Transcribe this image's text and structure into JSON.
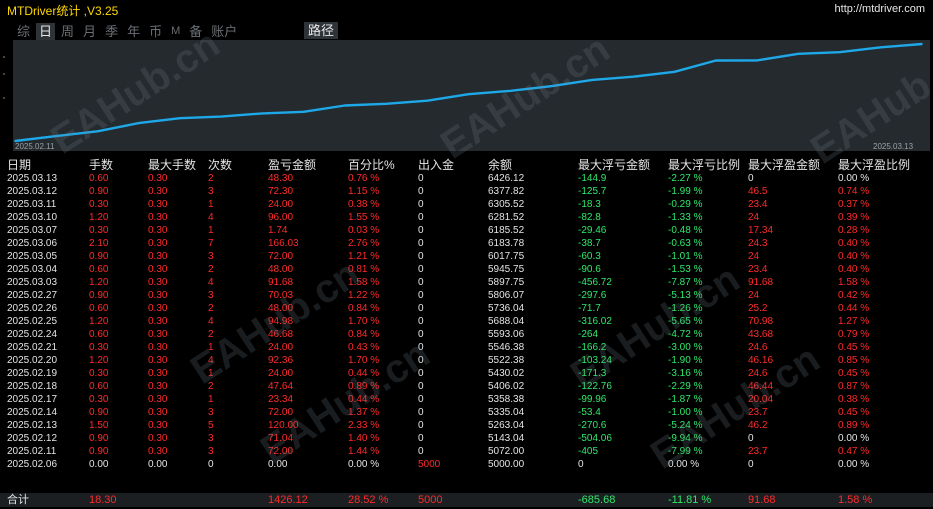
{
  "app": {
    "title": "MTDriver统计 ,V3.25",
    "url": "http://mtdriver.com"
  },
  "nav": {
    "items": [
      {
        "label": "综",
        "active": false
      },
      {
        "label": "日",
        "active": true
      },
      {
        "label": "周",
        "active": false
      },
      {
        "label": "月",
        "active": false
      },
      {
        "label": "季",
        "active": false
      },
      {
        "label": "年",
        "active": false
      },
      {
        "label": "币",
        "active": false
      },
      {
        "label": "M",
        "active": false
      },
      {
        "label": "备",
        "active": false
      },
      {
        "label": "账户",
        "active": false
      }
    ],
    "path_label": "路径"
  },
  "chart_data": {
    "type": "line",
    "x_start_label": "2025.02.11",
    "x_end_label": "2025.03.13",
    "line_color": "#1ea8e8",
    "background": "#242a2e",
    "x": [
      "2025.02.06",
      "2025.02.11",
      "2025.02.12",
      "2025.02.13",
      "2025.02.14",
      "2025.02.17",
      "2025.02.18",
      "2025.02.19",
      "2025.02.20",
      "2025.02.21",
      "2025.02.24",
      "2025.02.25",
      "2025.02.26",
      "2025.02.27",
      "2025.03.03",
      "2025.03.04",
      "2025.03.05",
      "2025.03.06",
      "2025.03.07",
      "2025.03.10",
      "2025.03.11",
      "2025.03.12",
      "2025.03.13"
    ],
    "values": [
      5000.0,
      5072.0,
      5143.04,
      5263.04,
      5335.04,
      5358.38,
      5406.02,
      5430.02,
      5522.38,
      5546.38,
      5593.06,
      5688.04,
      5736.04,
      5806.07,
      5897.75,
      5945.75,
      6017.75,
      6183.78,
      6185.52,
      6281.52,
      6305.52,
      6377.82,
      6426.12
    ]
  },
  "table": {
    "headers": [
      "日期",
      "手数",
      "最大手数",
      "次数",
      "盈亏金额",
      "百分比%",
      "出入金",
      "余额",
      "最大浮亏金额",
      "最大浮亏比例",
      "最大浮盈金额",
      "最大浮盈比例"
    ],
    "rows": [
      [
        "2025.03.13",
        "0.60",
        "0.30",
        "2",
        "48.30",
        "0.76 %",
        "0",
        "6426.12",
        "-144.9",
        "-2.27 %",
        "0",
        "0.00 %"
      ],
      [
        "2025.03.12",
        "0.90",
        "0.30",
        "3",
        "72.30",
        "1.15 %",
        "0",
        "6377.82",
        "-125.7",
        "-1.99 %",
        "46.5",
        "0.74 %"
      ],
      [
        "2025.03.11",
        "0.30",
        "0.30",
        "1",
        "24.00",
        "0.38 %",
        "0",
        "6305.52",
        "-18.3",
        "-0.29 %",
        "23.4",
        "0.37 %"
      ],
      [
        "2025.03.10",
        "1.20",
        "0.30",
        "4",
        "96.00",
        "1.55 %",
        "0",
        "6281.52",
        "-82.8",
        "-1.33 %",
        "24",
        "0.39 %"
      ],
      [
        "2025.03.07",
        "0.30",
        "0.30",
        "1",
        "1.74",
        "0.03 %",
        "0",
        "6185.52",
        "-29.46",
        "-0.48 %",
        "17.34",
        "0.28 %"
      ],
      [
        "2025.03.06",
        "2.10",
        "0.30",
        "7",
        "166.03",
        "2.76 %",
        "0",
        "6183.78",
        "-38.7",
        "-0.63 %",
        "24.3",
        "0.40 %"
      ],
      [
        "2025.03.05",
        "0.90",
        "0.30",
        "3",
        "72.00",
        "1.21 %",
        "0",
        "6017.75",
        "-60.3",
        "-1.01 %",
        "24",
        "0.40 %"
      ],
      [
        "2025.03.04",
        "0.60",
        "0.30",
        "2",
        "48.00",
        "0.81 %",
        "0",
        "5945.75",
        "-90.6",
        "-1.53 %",
        "23.4",
        "0.40 %"
      ],
      [
        "2025.03.03",
        "1.20",
        "0.30",
        "4",
        "91.68",
        "1.58 %",
        "0",
        "5897.75",
        "-456.72",
        "-7.87 %",
        "91.68",
        "1.58 %"
      ],
      [
        "2025.02.27",
        "0.90",
        "0.30",
        "3",
        "70.03",
        "1.22 %",
        "0",
        "5806.07",
        "-297.6",
        "-5.13 %",
        "24",
        "0.42 %"
      ],
      [
        "2025.02.26",
        "0.60",
        "0.30",
        "2",
        "48.00",
        "0.84 %",
        "0",
        "5736.04",
        "-71.7",
        "-1.26 %",
        "25.2",
        "0.44 %"
      ],
      [
        "2025.02.25",
        "1.20",
        "0.30",
        "4",
        "94.98",
        "1.70 %",
        "0",
        "5688.04",
        "-316.02",
        "-5.65 %",
        "70.98",
        "1.27 %"
      ],
      [
        "2025.02.24",
        "0.60",
        "0.30",
        "2",
        "46.68",
        "0.84 %",
        "0",
        "5593.06",
        "-264",
        "-4.72 %",
        "43.68",
        "0.79 %"
      ],
      [
        "2025.02.21",
        "0.30",
        "0.30",
        "1",
        "24.00",
        "0.43 %",
        "0",
        "5546.38",
        "-166.2",
        "-3.00 %",
        "24.6",
        "0.45 %"
      ],
      [
        "2025.02.20",
        "1.20",
        "0.30",
        "4",
        "92.36",
        "1.70 %",
        "0",
        "5522.38",
        "-103.24",
        "-1.90 %",
        "46.16",
        "0.85 %"
      ],
      [
        "2025.02.19",
        "0.30",
        "0.30",
        "1",
        "24.00",
        "0.44 %",
        "0",
        "5430.02",
        "-171.3",
        "-3.16 %",
        "24.6",
        "0.45 %"
      ],
      [
        "2025.02.18",
        "0.60",
        "0.30",
        "2",
        "47.64",
        "0.89 %",
        "0",
        "5406.02",
        "-122.76",
        "-2.29 %",
        "46.44",
        "0.87 %"
      ],
      [
        "2025.02.17",
        "0.30",
        "0.30",
        "1",
        "23.34",
        "0.44 %",
        "0",
        "5358.38",
        "-99.96",
        "-1.87 %",
        "20.04",
        "0.38 %"
      ],
      [
        "2025.02.14",
        "0.90",
        "0.30",
        "3",
        "72.00",
        "1.37 %",
        "0",
        "5335.04",
        "-53.4",
        "-1.00 %",
        "23.7",
        "0.45 %"
      ],
      [
        "2025.02.13",
        "1.50",
        "0.30",
        "5",
        "120.00",
        "2.33 %",
        "0",
        "5263.04",
        "-270.6",
        "-5.24 %",
        "46.2",
        "0.89 %"
      ],
      [
        "2025.02.12",
        "0.90",
        "0.30",
        "3",
        "71.04",
        "1.40 %",
        "0",
        "5143.04",
        "-504.06",
        "-9.94 %",
        "0",
        "0.00 %"
      ],
      [
        "2025.02.11",
        "0.90",
        "0.30",
        "3",
        "72.00",
        "1.44 %",
        "0",
        "5072.00",
        "-405",
        "-7.99 %",
        "23.7",
        "0.47 %"
      ],
      [
        "2025.02.06",
        "0.00",
        "0.00",
        "0",
        "0.00",
        "0.00 %",
        "5000",
        "5000.00",
        "0",
        "0.00 %",
        "0",
        "0.00 %"
      ]
    ],
    "total": [
      "合计",
      "18.30",
      "",
      "",
      "1426.12",
      "28.52 %",
      "5000",
      "",
      "-685.68",
      "-11.81 %",
      "91.68",
      "1.58 %"
    ]
  },
  "watermark": "EAHub.cn",
  "colors": {
    "positive": "#ff2a2a",
    "negative": "#2ee86a",
    "neutral": "#e4e4e4",
    "title": "#ffd800"
  }
}
